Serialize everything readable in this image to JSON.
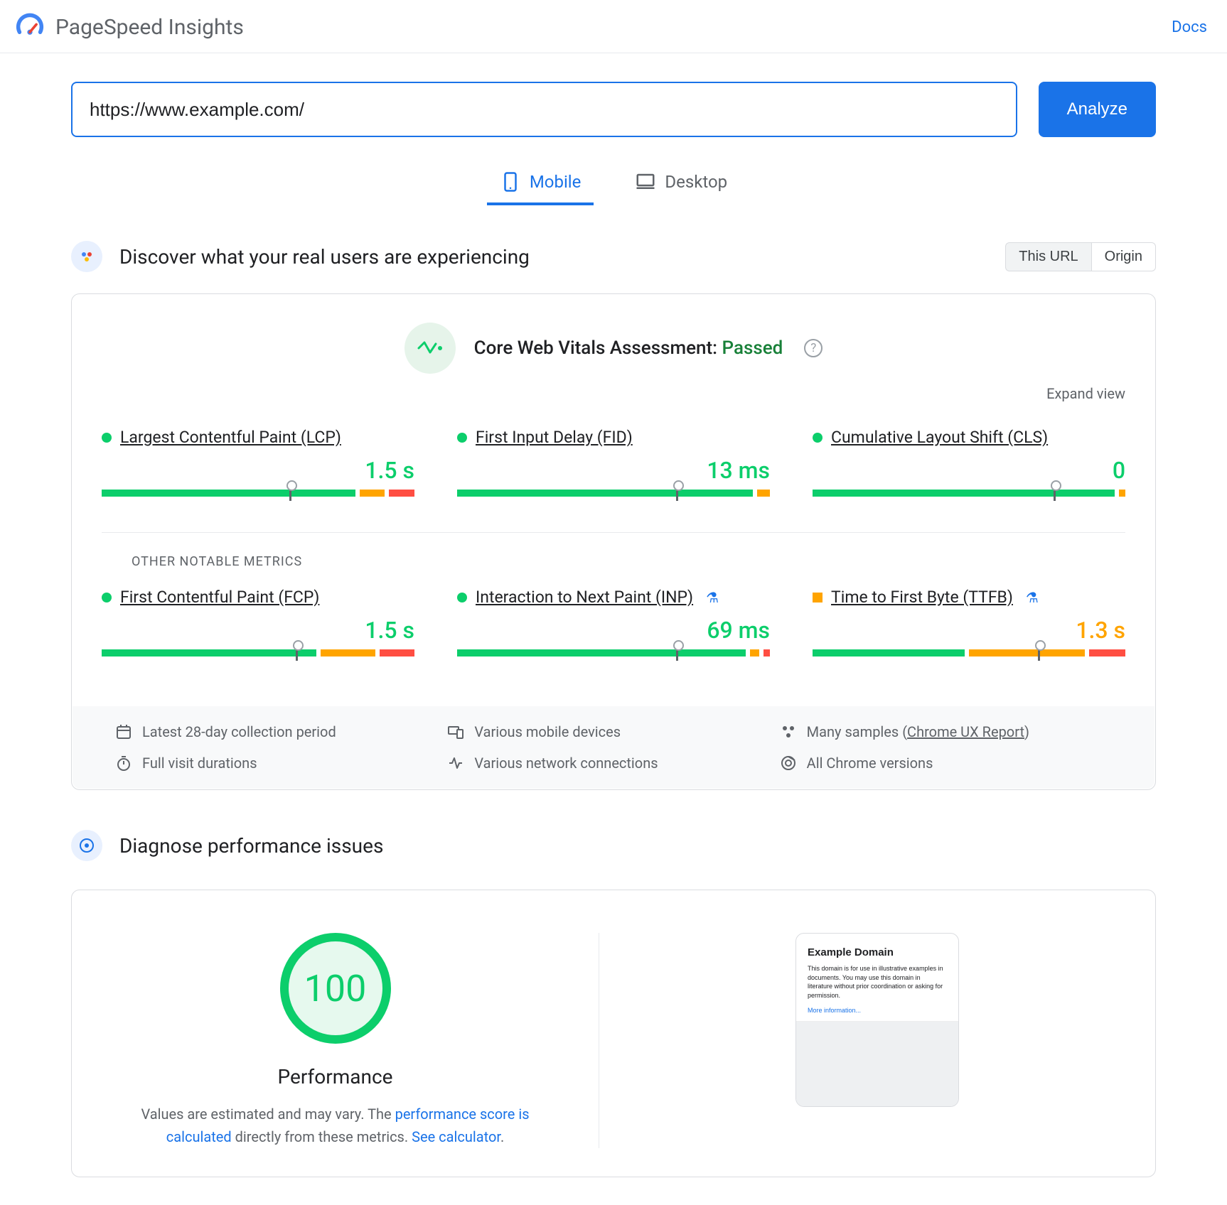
{
  "header": {
    "title": "PageSpeed Insights",
    "docs": "Docs"
  },
  "url_input": {
    "value": "https://www.example.com/",
    "analyze": "Analyze"
  },
  "device_tabs": {
    "mobile": "Mobile",
    "desktop": "Desktop",
    "active": "mobile"
  },
  "field_section": {
    "title": "Discover what your real users are experiencing",
    "toggle": {
      "this_url": "This URL",
      "origin": "Origin",
      "active": "this_url"
    }
  },
  "cwv": {
    "label": "Core Web Vitals Assessment: ",
    "status": "Passed",
    "expand": "Expand view"
  },
  "metrics_primary": [
    {
      "name": "Largest Contentful Paint (LCP)",
      "value": "1.5 s",
      "status": "green",
      "dist": {
        "g": 60,
        "o": 6,
        "r": 6
      },
      "marker": 60
    },
    {
      "name": "First Input Delay (FID)",
      "value": "13 ms",
      "status": "green",
      "dist": {
        "g": 92,
        "o": 4,
        "r": 0
      },
      "marker": 70
    },
    {
      "name": "Cumulative Layout Shift (CLS)",
      "value": "0",
      "status": "green",
      "dist": {
        "g": 98,
        "o": 2,
        "r": 0
      },
      "marker": 77
    }
  ],
  "other_heading": "OTHER NOTABLE METRICS",
  "metrics_other": [
    {
      "name": "First Contentful Paint (FCP)",
      "value": "1.5 s",
      "status": "green",
      "dist": {
        "g": 62,
        "o": 16,
        "r": 10
      },
      "marker": 62,
      "experimental": false
    },
    {
      "name": "Interaction to Next Paint (INP)",
      "value": "69 ms",
      "status": "green",
      "dist": {
        "g": 94,
        "o": 3,
        "r": 2
      },
      "marker": 70,
      "experimental": true
    },
    {
      "name": "Time to First Byte (TTFB)",
      "value": "1.3 s",
      "status": "orange",
      "dist": {
        "g": 50,
        "o": 38,
        "r": 12
      },
      "marker": 72,
      "experimental": true
    }
  ],
  "meta": {
    "period": "Latest 28-day collection period",
    "devices": "Various mobile devices",
    "samples_prefix": "Many samples (",
    "samples_link": "Chrome UX Report",
    "samples_suffix": ")",
    "durations": "Full visit durations",
    "network": "Various network connections",
    "versions": "All Chrome versions"
  },
  "diagnose": {
    "title": "Diagnose performance issues",
    "score": "100",
    "label": "Performance",
    "desc_prefix": "Values are estimated and may vary. The ",
    "desc_link1": "performance score is calculated",
    "desc_mid": " directly from these metrics. ",
    "desc_link2": "See calculator",
    "desc_suffix": "."
  },
  "preview": {
    "title": "Example Domain",
    "text": "This domain is for use in illustrative examples in documents. You may use this domain in literature without prior coordination or asking for permission.",
    "link": "More information..."
  }
}
